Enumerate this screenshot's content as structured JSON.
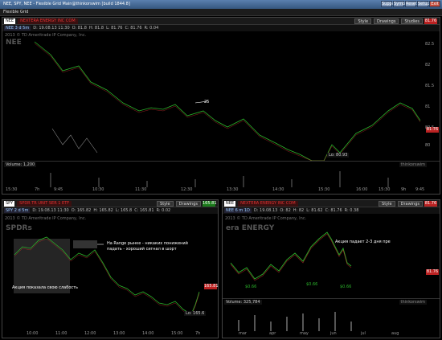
{
  "window_title": "NEE, SPY, NEE - Flexible Grid Main@thinkorswim [build 1844.8]",
  "window_buttons": [
    "Support",
    "Symbol",
    "Reset",
    "Setup",
    "Exit"
  ],
  "menu_label": "Flexible Grid",
  "top_panel": {
    "symbol": "NEE",
    "company": "NEXTERA ENERGY INC COM",
    "style": "Style",
    "drawings": "Drawings",
    "studies": "Studies",
    "quote": {
      "sym": "NEE 3 d 5m",
      "date": "D: 19.08.13 11:30",
      "open": "O: 81.8",
      "high": "H: 81.8",
      "low": "L: 81.76",
      "close": "C: 81.76",
      "range": "R: 0.04"
    },
    "copyright": "2013 © TD Ameritrade IP Company, Inc.",
    "watermark": "NEE",
    "last_price": "81.76",
    "low_label": "Lo: 80.93",
    "marker_label": "25",
    "volume_label": "Volume: 1,200",
    "volume_tag": "thinkorswim",
    "y_ticks": [
      "82.5",
      "82",
      "81.5",
      "81",
      "80.5",
      "80"
    ],
    "x_ticks": [
      "15:30",
      "7h",
      "9:45",
      "10:30",
      "11:30",
      "12:30",
      "13:30",
      "14:30",
      "15:30",
      "16:00",
      "15:30",
      "9h",
      "9:45"
    ]
  },
  "left_panel": {
    "symbol": "SPY",
    "company": "SPDR TR UNIT SER 1 ETF",
    "style": "Style",
    "drawings": "Drawings",
    "last_price": "165.81",
    "quote": {
      "sym": "SPY 2 d 5m",
      "date": "D: 19.08.13 11:30",
      "open": "O: 165.82",
      "high": "H: 165.82",
      "low": "L: 165.8",
      "close": "C: 165.81",
      "range": "R: 0.02"
    },
    "copyright": "2013 © TD Ameritrade IP Company, Inc.",
    "watermark": "SPDRs",
    "annotation_1": "На Range рынке - никаких понижений",
    "annotation_2": "падать - хороший сигнал в шорт",
    "annotation_3": "Акция показала свою слабость",
    "price_tag": "165.81",
    "low_label": "Lo: 165.6",
    "x_ticks": [
      "10:00",
      "11:00",
      "12:00",
      "13:00",
      "14:00",
      "15:00",
      "7h"
    ]
  },
  "right_panel": {
    "symbol": "NEE",
    "company": "NEXTERA ENERGY INC COM",
    "style": "Style",
    "drawings": "Drawings",
    "last_price": "81.76",
    "quote": {
      "sym": "NEE 6 m 1D",
      "date": "D: 19.08.13",
      "open": "O: 82",
      "high": "H: 82",
      "low": "L: 81.62",
      "close": "C: 81.76",
      "range": "R: 0.38"
    },
    "copyright": "2013 © TD Ameritrade IP Company, Inc.",
    "watermark": "era ENERGY",
    "annotation": "Акция падает 2-3 дня пре",
    "price_tag": "81.76",
    "event_labels": [
      "$0.66",
      "$0.66",
      "$0.66"
    ],
    "volume_label": "Volume: 325,784",
    "volume_tag": "thinkorswim",
    "x_ticks": [
      "mar",
      "apr",
      "may",
      "jun",
      "jul",
      "aug"
    ]
  },
  "colors": {
    "up": "#2bb32b",
    "down": "#cc2b2b",
    "price_red": "#bb2222"
  }
}
